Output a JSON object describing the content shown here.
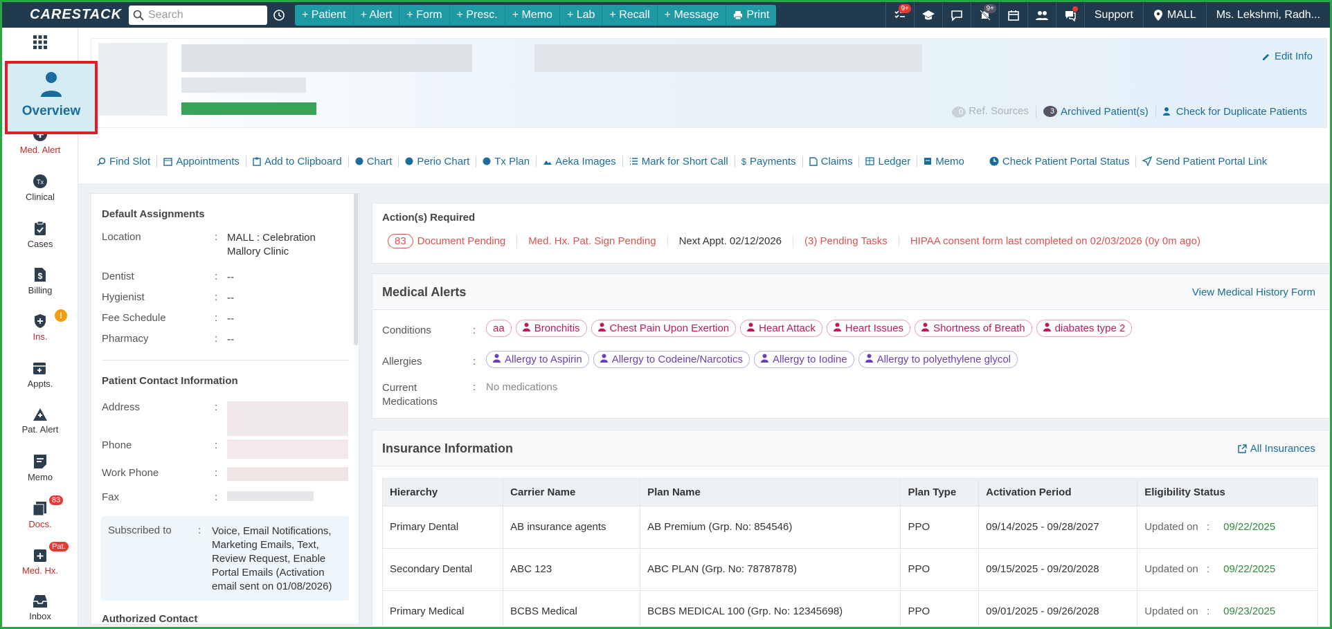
{
  "topbar": {
    "logo": "CARESTACK",
    "search_placeholder": "Search",
    "quick_actions": [
      "+ Patient",
      "+ Alert",
      "+ Form",
      "+ Presc.",
      "+ Memo",
      "+ Lab",
      "+ Recall",
      "+ Message",
      "Print"
    ],
    "badges": {
      "tasks": "9+",
      "notifications": "9+"
    },
    "support_label": "Support",
    "location_label": "MALL",
    "user_label": "Ms. Lekshmi, Radh..."
  },
  "sidebar": {
    "overview_label": "Overview",
    "items": [
      {
        "label": "Med. Alert",
        "icon": "medical-alert-icon",
        "alert": true
      },
      {
        "label": "Clinical",
        "icon": "tx-icon"
      },
      {
        "label": "Cases",
        "icon": "clipboard-icon"
      },
      {
        "label": "Billing",
        "icon": "dollar-doc-icon"
      },
      {
        "label": "Ins.",
        "icon": "insurance-shield-icon",
        "alert": true,
        "badge": "!"
      },
      {
        "label": "Appts.",
        "icon": "calendar-icon"
      },
      {
        "label": "Pat. Alert",
        "icon": "warning-triangle-icon"
      },
      {
        "label": "Memo",
        "icon": "memo-icon"
      },
      {
        "label": "Docs.",
        "icon": "documents-icon",
        "alert": true,
        "badge": "83"
      },
      {
        "label": "Med. Hx.",
        "icon": "medical-history-icon",
        "alert": true,
        "badge": "Pat."
      },
      {
        "label": "Inbox",
        "icon": "inbox-icon"
      }
    ]
  },
  "header": {
    "edit_info": "Edit Info",
    "ref_sources_count": "0",
    "ref_sources": "Ref. Sources",
    "archived_count": "3",
    "archived": "Archived Patient(s)",
    "duplicates": "Check for Duplicate Patients"
  },
  "actions": [
    "Find Slot",
    "Appointments",
    "Add to Clipboard",
    "Chart",
    "Perio Chart",
    "Tx Plan",
    "Aeka Images",
    "Mark for Short Call",
    "Payments",
    "Claims",
    "Ledger",
    "Memo",
    "Check Patient Portal Status",
    "Send Patient Portal Link"
  ],
  "default_assignments": {
    "title": "Default Assignments",
    "rows": [
      {
        "k": "Location",
        "v": "MALL : Celebration Mallory Clinic"
      },
      {
        "k": "Dentist",
        "v": "--"
      },
      {
        "k": "Hygienist",
        "v": "--"
      },
      {
        "k": "Fee Schedule",
        "v": "--"
      },
      {
        "k": "Pharmacy",
        "v": "--"
      }
    ]
  },
  "contact": {
    "title": "Patient Contact Information",
    "address": "Address",
    "phone": "Phone",
    "work_phone": "Work Phone",
    "fax": "Fax",
    "subscribed_label": "Subscribed to",
    "subscribed_value": "Voice, Email Notifications, Marketing Emails, Text, Review Request, Enable Portal Emails (Activation email sent on 01/08/2026)",
    "authorized": "Authorized Contact"
  },
  "actions_required": {
    "title": "Action(s) Required",
    "doc_count": "83",
    "doc_pending": "Document Pending",
    "med_hx": "Med. Hx. Pat. Sign Pending",
    "next_appt": "Next Appt. 02/12/2026",
    "tasks": "(3) Pending Tasks",
    "hipaa": "HIPAA consent form last completed on 02/03/2026 (0y 0m ago)"
  },
  "medical_alerts": {
    "title": "Medical Alerts",
    "view_link": "View Medical History Form",
    "conditions_label": "Conditions",
    "conditions": [
      "aa",
      "Bronchitis",
      "Chest Pain Upon Exertion",
      "Heart Attack",
      "Heart Issues",
      "Shortness of Breath",
      "diabates type 2"
    ],
    "allergies_label": "Allergies",
    "allergies": [
      "Allergy to Aspirin",
      "Allergy to Codeine/Narcotics",
      "Allergy to Iodine",
      "Allergy to polyethylene glycol"
    ],
    "meds_label": "Current Medications",
    "meds_value": "No medications"
  },
  "insurance": {
    "title": "Insurance Information",
    "all_link": "All Insurances",
    "columns": [
      "Hierarchy",
      "Carrier Name",
      "Plan Name",
      "Plan Type",
      "Activation Period",
      "Eligibility Status"
    ],
    "updated_on": "Updated on",
    "rows": [
      {
        "h": "Primary Dental",
        "carrier": "AB insurance agents",
        "plan": "AB Premium (Grp. No: 854546)",
        "type": "PPO",
        "period": "09/14/2025 - 09/28/2027",
        "date": "09/22/2025"
      },
      {
        "h": "Secondary Dental",
        "carrier": "ABC 123",
        "plan": "ABC PLAN (Grp. No: 78787878)",
        "type": "PPO",
        "period": "09/15/2025 - 09/20/2028",
        "date": "09/22/2025"
      },
      {
        "h": "Primary Medical",
        "carrier": "BCBS Medical",
        "plan": "BCBS MEDICAL 100 (Grp. No: 12345698)",
        "type": "PPO",
        "period": "09/01/2025 - 09/26/2028",
        "date": "09/23/2025"
      }
    ]
  }
}
